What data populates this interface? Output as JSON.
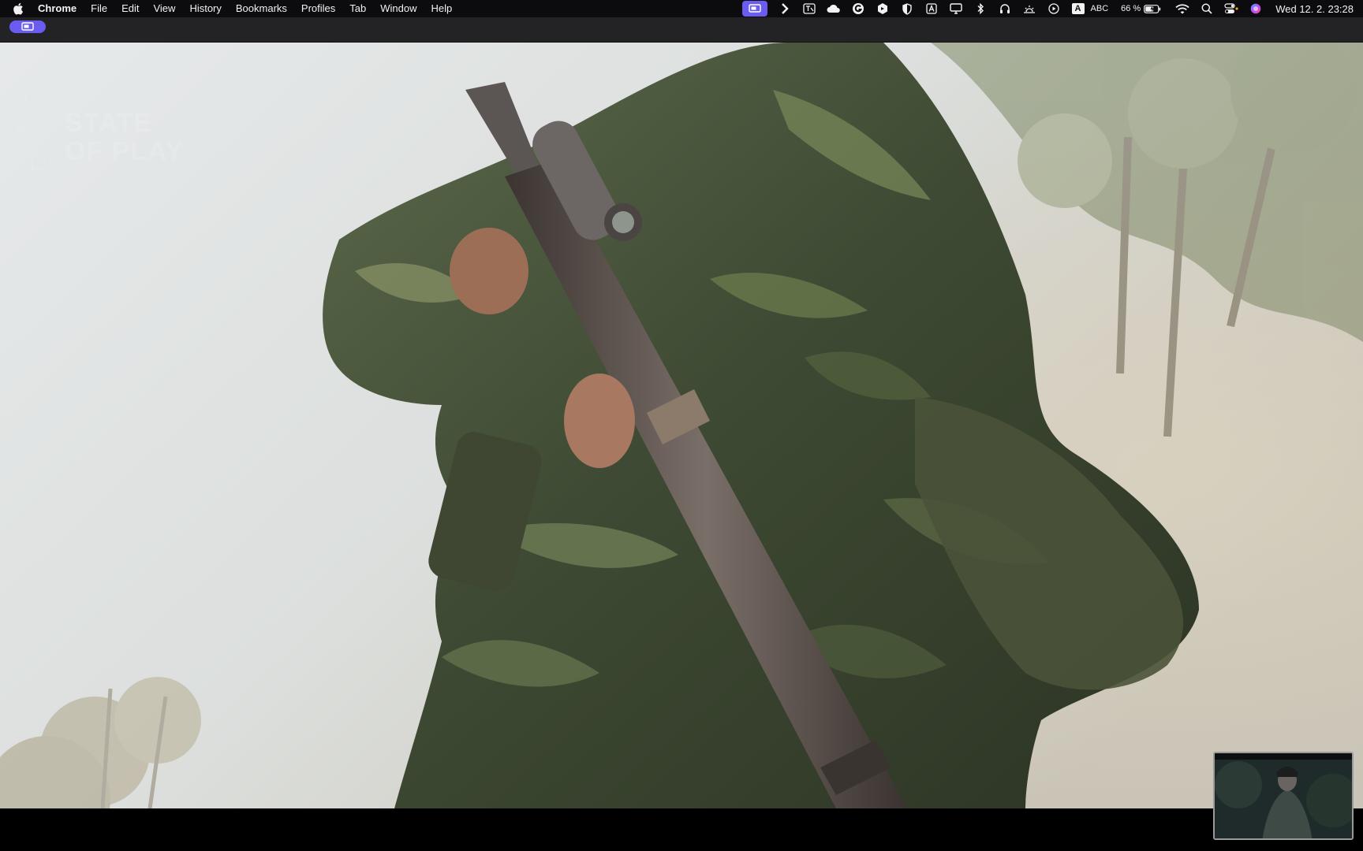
{
  "menubar": {
    "app_name": "Chrome",
    "items": [
      "File",
      "Edit",
      "View",
      "History",
      "Bookmarks",
      "Profiles",
      "Tab",
      "Window",
      "Help"
    ],
    "status": {
      "input_source": "ABC",
      "battery": "66 %",
      "datetime": "Wed 12. 2.  23:28"
    }
  },
  "video": {
    "watermark_line1": "STATE",
    "watermark_line2": "OF PLAY"
  },
  "colors": {
    "menubar_bg": "#0c0c0e",
    "accent": "#6a5cf0",
    "strip_bg": "#232325"
  }
}
